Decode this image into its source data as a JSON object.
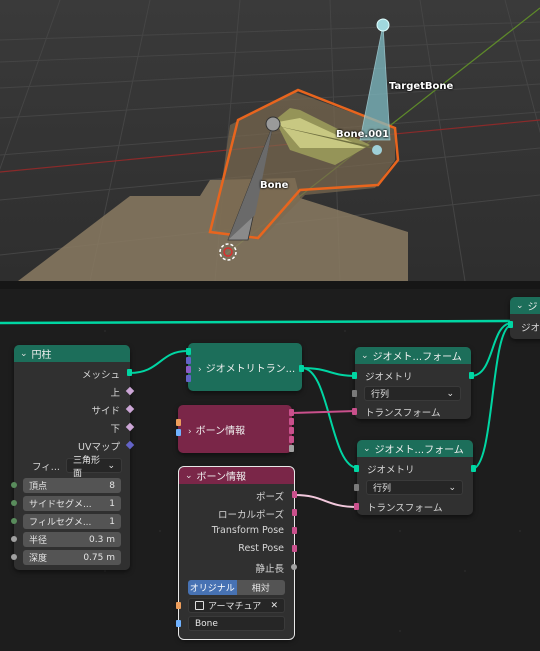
{
  "viewport": {
    "bones": {
      "bone": "Bone",
      "bone001": "Bone.001",
      "target": "TargetBone"
    }
  },
  "nodes": {
    "cylinder": {
      "title": "円柱",
      "outputs": [
        "メッシュ",
        "上",
        "サイド",
        "下",
        "UVマップ"
      ],
      "fill_label": "フィ...",
      "fill_value": "三角形面",
      "fields": [
        {
          "label": "頂点",
          "value": "8"
        },
        {
          "label": "サイドセグメ...",
          "value": "1"
        },
        {
          "label": "フィルセグメ...",
          "value": "1"
        },
        {
          "label": "半径",
          "value": "0.3 m"
        },
        {
          "label": "深度",
          "value": "0.75 m"
        }
      ]
    },
    "transform_collapsed": {
      "title": "ジオメトリトラン..."
    },
    "bone_info_collapsed": {
      "title": "ボーン情報"
    },
    "bone_info": {
      "title": "ボーン情報",
      "outputs": [
        "ポーズ",
        "ローカルポーズ",
        "Transform Pose",
        "Rest Pose",
        "静止長"
      ],
      "toggle_original": "オリジナル",
      "toggle_relative": "相対",
      "armature_value": "アーマチュア",
      "bone_name": "Bone"
    },
    "geo_transform_1": {
      "title": "ジオメト...フォーム",
      "geometry": "ジオメトリ",
      "mode": "行列",
      "transform": "トランスフォーム"
    },
    "geo_transform_2": {
      "title": "ジオメト...フォーム",
      "geometry": "ジオメトリ",
      "mode": "行列",
      "transform": "トランスフォーム"
    },
    "partial_node": {
      "title": "ジ",
      "geometry": "ジオメ"
    }
  },
  "colors": {
    "geometry_socket": "#00d6a3",
    "matrix_socket": "#c9508c",
    "vector_socket": "#6363c7",
    "bool_socket": "#cca6d6",
    "float_socket": "#a1a1a1",
    "int_socket": "#598c5c",
    "string_socket": "#70b2ff",
    "object_socket": "#ed9e5c",
    "geometry_header": "#1c6e5a",
    "object_header": "#7a2648"
  }
}
